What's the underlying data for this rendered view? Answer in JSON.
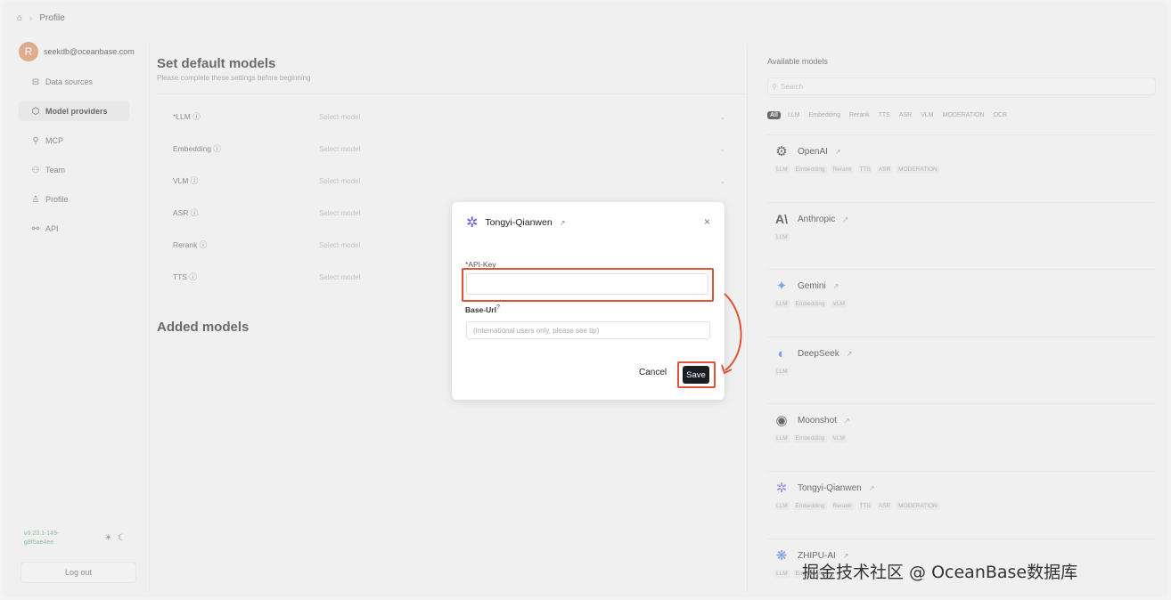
{
  "breadcrumb": {
    "home_icon": "home-icon",
    "current": "Profile"
  },
  "sidebar": {
    "avatar_letter": "R",
    "email": "seekdb@oceanbase.com",
    "items": [
      {
        "label": "Data sources",
        "icon": "database-icon"
      },
      {
        "label": "Model providers",
        "icon": "box-icon",
        "active": true
      },
      {
        "label": "MCP",
        "icon": "mcp-icon"
      },
      {
        "label": "Team",
        "icon": "team-icon"
      },
      {
        "label": "Profile",
        "icon": "user-icon"
      },
      {
        "label": "API",
        "icon": "api-icon"
      }
    ],
    "version": "v0.23.1-149-g8f5ae4ee",
    "logout": "Log out"
  },
  "main": {
    "title": "Set default models",
    "subtitle": "Please complete these settings before beginning",
    "rows": [
      {
        "label": "*LLM ⓘ",
        "placeholder": "Select model"
      },
      {
        "label": "Embedding ⓘ",
        "placeholder": "Select model"
      },
      {
        "label": "VLM ⓘ",
        "placeholder": "Select model"
      },
      {
        "label": "ASR ⓘ",
        "placeholder": "Select model"
      },
      {
        "label": "Rerank ⓘ",
        "placeholder": "Select model"
      },
      {
        "label": "TTS ⓘ",
        "placeholder": "Select model"
      }
    ],
    "added_title": "Added models"
  },
  "right": {
    "title": "Available models",
    "search_placeholder": "Search",
    "filters": [
      "All",
      "LLM",
      "Embedding",
      "Rerank",
      "TTS",
      "ASR",
      "VLM",
      "MODERATION",
      "OCR"
    ],
    "providers": [
      {
        "name": "OpenAI",
        "tags": [
          "LLM",
          "Embedding",
          "Rerank",
          "TTS",
          "ASR",
          "MODERATION"
        ]
      },
      {
        "name": "Anthropic",
        "tags": [
          "LLM"
        ]
      },
      {
        "name": "Gemini",
        "tags": [
          "LLM",
          "Embedding",
          "VLM"
        ]
      },
      {
        "name": "DeepSeek",
        "tags": [
          "LLM"
        ]
      },
      {
        "name": "Moonshot",
        "tags": [
          "LLM",
          "Embedding",
          "VLM"
        ]
      },
      {
        "name": "Tongyi-Qianwen",
        "tags": [
          "LLM",
          "Embedding",
          "Rerank",
          "TTS",
          "ASR",
          "MODERATION"
        ]
      },
      {
        "name": "ZHIPU-AI",
        "tags": [
          "LLM",
          "Embedding"
        ]
      }
    ]
  },
  "modal": {
    "title": "Tongyi-Qianwen",
    "api_key_label": "*API-Key",
    "base_url_label": "Base-Url",
    "base_url_placeholder": "(International users only, please see tip)",
    "cancel": "Cancel",
    "save": "Save"
  },
  "watermark": "掘金技术社区 @ OceanBase数据库",
  "colors": {
    "highlight": "#e0533a",
    "save_bg": "#1a1d24"
  }
}
